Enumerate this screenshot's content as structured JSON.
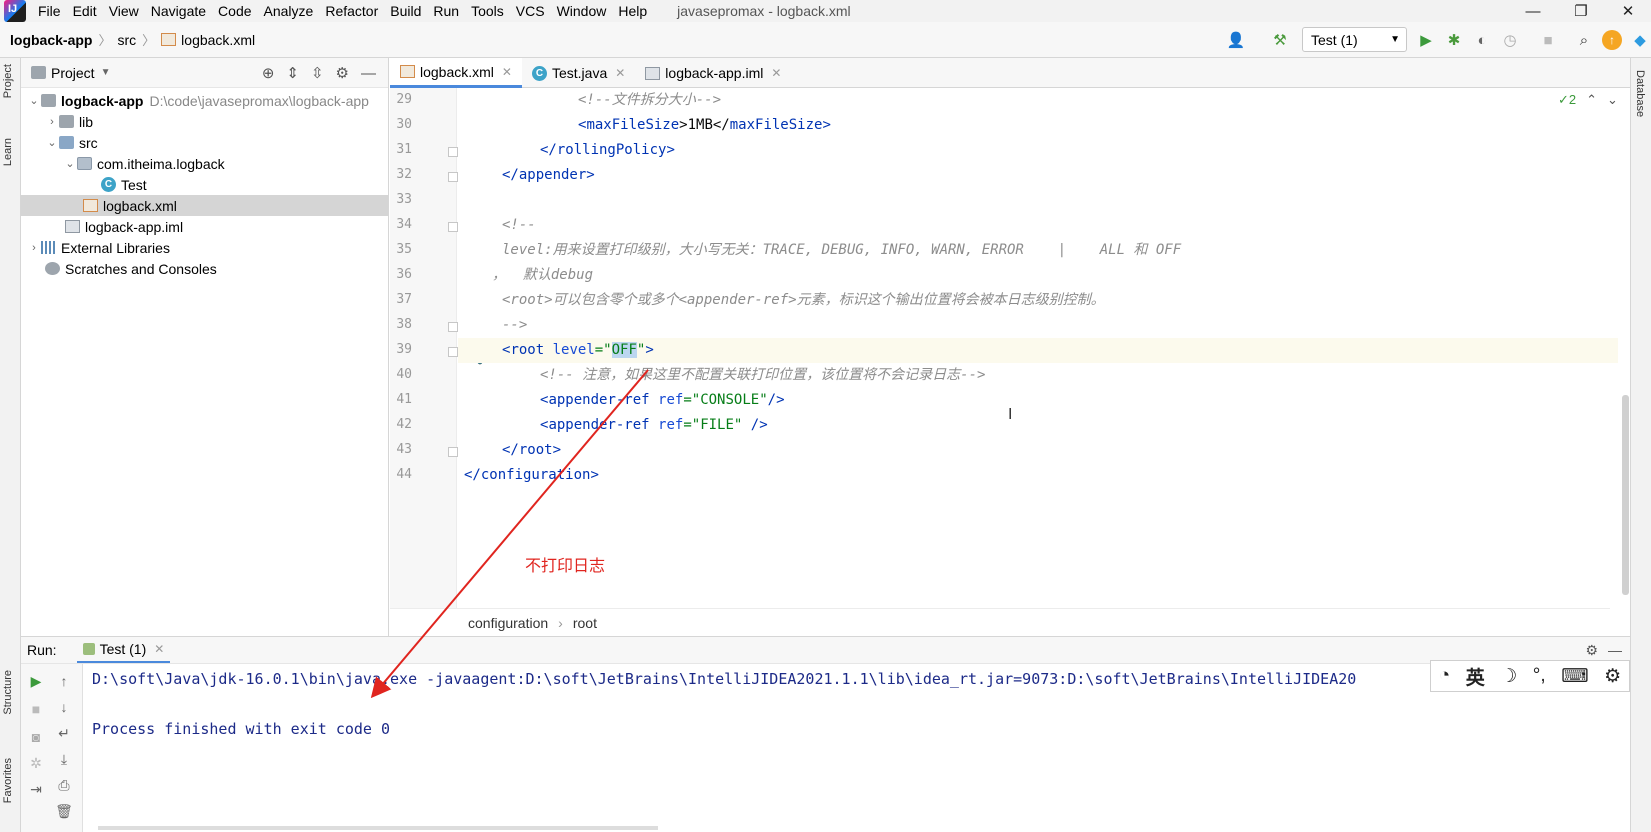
{
  "menubar": {
    "items": [
      "File",
      "Edit",
      "View",
      "Navigate",
      "Code",
      "Analyze",
      "Refactor",
      "Build",
      "Run",
      "Tools",
      "VCS",
      "Window",
      "Help"
    ],
    "window_title": "javasepromax - logback.xml",
    "minimize": "—",
    "restore": "❐",
    "close": "✕"
  },
  "navbar": {
    "crumbs": [
      "logback-app",
      "src",
      "logback.xml"
    ],
    "run_config": "Test (1)",
    "icons": [
      "user-icon",
      "hammer-icon",
      "run-icon",
      "debug-icon",
      "coverage-icon",
      "profile-icon",
      "stop-icon",
      "search-icon",
      "update-icon",
      "toolbox-icon"
    ]
  },
  "left_strip": {
    "project_tab": "Project",
    "learn_tab": "Learn",
    "structure_tab": "Structure",
    "favorites_tab": "Favorites"
  },
  "right_strip": {
    "database_tab": "Database"
  },
  "project": {
    "header": "Project",
    "tree": [
      {
        "label": "logback-app",
        "hint": "D:\\code\\javasepromax\\logback-app"
      },
      {
        "label": "lib"
      },
      {
        "label": "src"
      },
      {
        "label": "com.itheima.logback"
      },
      {
        "label": "Test"
      },
      {
        "label": "logback.xml"
      },
      {
        "label": "logback-app.iml"
      },
      {
        "label": "External Libraries"
      },
      {
        "label": "Scratches and Consoles"
      }
    ]
  },
  "editor": {
    "tabs": [
      "logback.xml",
      "Test.java",
      "logback-app.iml"
    ],
    "inspection_count": "2",
    "line_numbers": [
      "29",
      "30",
      "31",
      "32",
      "33",
      "34",
      "35",
      "36",
      "37",
      "38",
      "39",
      "40",
      "41",
      "42",
      "43",
      "44"
    ],
    "lines": {
      "l29": "<!--文件拆分大小-->",
      "l30_open": "<",
      "l30_tag": "maxFileSize",
      "l30_text": ">1MB</",
      "l30_tag2": "maxFileSize",
      "l30_close": ">",
      "l31_tag": "rollingPolicy",
      "l32_tag": "appender",
      "l34": "<!--",
      "l35": "level:用来设置打印级别，大小写无关：TRACE, DEBUG, INFO, WARN, ERROR    |    ALL 和 OFF",
      "l36": "，  默认debug",
      "l37": "<root>可以包含零个或多个<appender-ref>元素，标识这个输出位置将会被本日志级别控制。",
      "l38": "-->",
      "l39_tag": "root",
      "l39_attr": "level",
      "l39_val": "OFF",
      "l40": "<!-- 注意，如果这里不配置关联打印位置，该位置将不会记录日志-->",
      "l41_tag": "appender-ref",
      "l41_attr": "ref",
      "l41_val": "CONSOLE",
      "l42_tag": "appender-ref",
      "l42_attr": "ref",
      "l42_val": "FILE",
      "l43_tag": "root",
      "l44_tag": "configuration"
    },
    "breadcrumb": [
      "configuration",
      "root"
    ]
  },
  "annotation": "不打印日志",
  "run_panel": {
    "label": "Run:",
    "tab": "Test (1)",
    "console_line1": "D:\\soft\\Java\\jdk-16.0.1\\bin\\java.exe -javaagent:D:\\soft\\JetBrains\\IntelliJIDEA2021.1.1\\lib\\idea_rt.jar=9073:D:\\soft\\JetBrains\\IntelliJIDEA20",
    "console_line2": "Process finished with exit code 0"
  },
  "ime": {
    "lang": "英",
    "moon": "☽",
    "punct": "°,",
    "keyboard": "⌨",
    "gear": "⚙"
  }
}
